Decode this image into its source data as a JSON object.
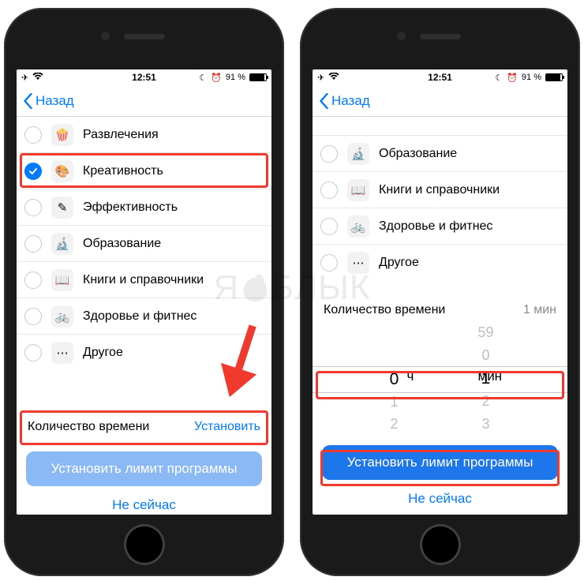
{
  "statusbar": {
    "time": "12:51",
    "battery_pct": "91 %"
  },
  "nav": {
    "back": "Назад"
  },
  "left": {
    "categories": [
      {
        "label": "Развлечения",
        "emoji": "🍿",
        "checked": false
      },
      {
        "label": "Креативность",
        "emoji": "🎨",
        "checked": true
      },
      {
        "label": "Эффективность",
        "emoji": "✎",
        "checked": false
      },
      {
        "label": "Образование",
        "emoji": "🔬",
        "checked": false
      },
      {
        "label": "Книги и справочники",
        "emoji": "📖",
        "checked": false
      },
      {
        "label": "Здоровье и фитнес",
        "emoji": "🚲",
        "checked": false
      },
      {
        "label": "Другое",
        "emoji": "⋯",
        "checked": false
      }
    ],
    "time_section_title": "Количество времени",
    "time_section_action": "Установить",
    "cta": "Установить лимит программы",
    "dismiss": "Не сейчас"
  },
  "right": {
    "categories": [
      {
        "label": "Образование",
        "emoji": "🔬",
        "checked": false
      },
      {
        "label": "Книги и справочники",
        "emoji": "📖",
        "checked": false
      },
      {
        "label": "Здоровье и фитнес",
        "emoji": "🚲",
        "checked": false
      },
      {
        "label": "Другое",
        "emoji": "⋯",
        "checked": false
      }
    ],
    "time_section_title": "Количество времени",
    "time_section_value": "1 мин",
    "picker": {
      "hours_unit": "ч",
      "minutes_unit": "мин",
      "hours": {
        "prev": "",
        "sel": "0",
        "next1": "1",
        "next2": "2"
      },
      "minutes": {
        "prev2": "59",
        "prev1": "0",
        "sel": "1",
        "next1": "2",
        "next2": "3"
      }
    },
    "cta": "Установить лимит программы",
    "dismiss": "Не сейчас"
  },
  "watermark": "ЯБЛЫК"
}
